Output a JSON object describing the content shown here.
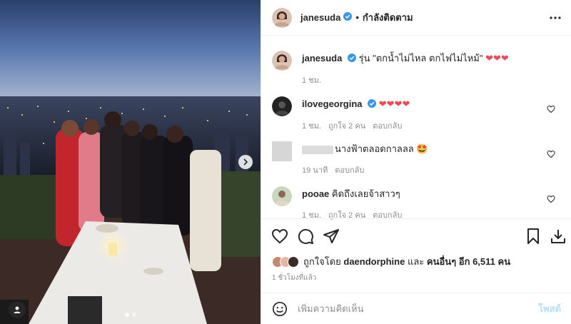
{
  "post": {
    "username": "janesuda",
    "follow_status": "กำลังติดตาม",
    "separator": "•"
  },
  "caption": {
    "username": "janesuda",
    "text": "รุ่น \"ตกน้ำไม่ไหล ตกไฟไม่ไหม้\" ",
    "emoji": "❤❤❤",
    "time": "1 ชม."
  },
  "comments": [
    {
      "username": "ilovegeorgina",
      "text": "",
      "emoji": "❤❤❤❤",
      "time": "1 ชม.",
      "likes": "ถูกใจ 2 คน",
      "reply": "ตอบกลับ"
    },
    {
      "username": "",
      "text": "นางฟ้าตลอดกาลลล",
      "emoji": "🤩",
      "time": "19 นาที",
      "likes": "",
      "reply": "ตอบกลับ"
    },
    {
      "username": "pooae",
      "text": "คิดถึงเลยจ้าสาวๆ",
      "emoji": "",
      "time": "1 ชม.",
      "likes": "ถูกใจ 2 คน",
      "reply": "ตอบกลับ"
    }
  ],
  "likes_line": {
    "prefix": "ถูกใจโดย",
    "user": "daendorphine",
    "middle": "และ",
    "others": "คนอื่นๆ อีก 6,511 คน"
  },
  "posted": "1 ชั่วโมงที่แล้ว",
  "composer": {
    "placeholder": "เพิ่มความคิดเห็น",
    "post_label": "โพสต์"
  },
  "colors": {
    "heart_red": "#ed4956",
    "verified_blue": "#3897f0",
    "post_button_disabled": "#b2dffc"
  },
  "icons": [
    "verified-icon",
    "more-icon",
    "heart-outline-icon",
    "comment-icon",
    "share-icon",
    "bookmark-icon",
    "download-icon",
    "emoji-icon",
    "chevron-right-icon",
    "user-tag-icon"
  ]
}
